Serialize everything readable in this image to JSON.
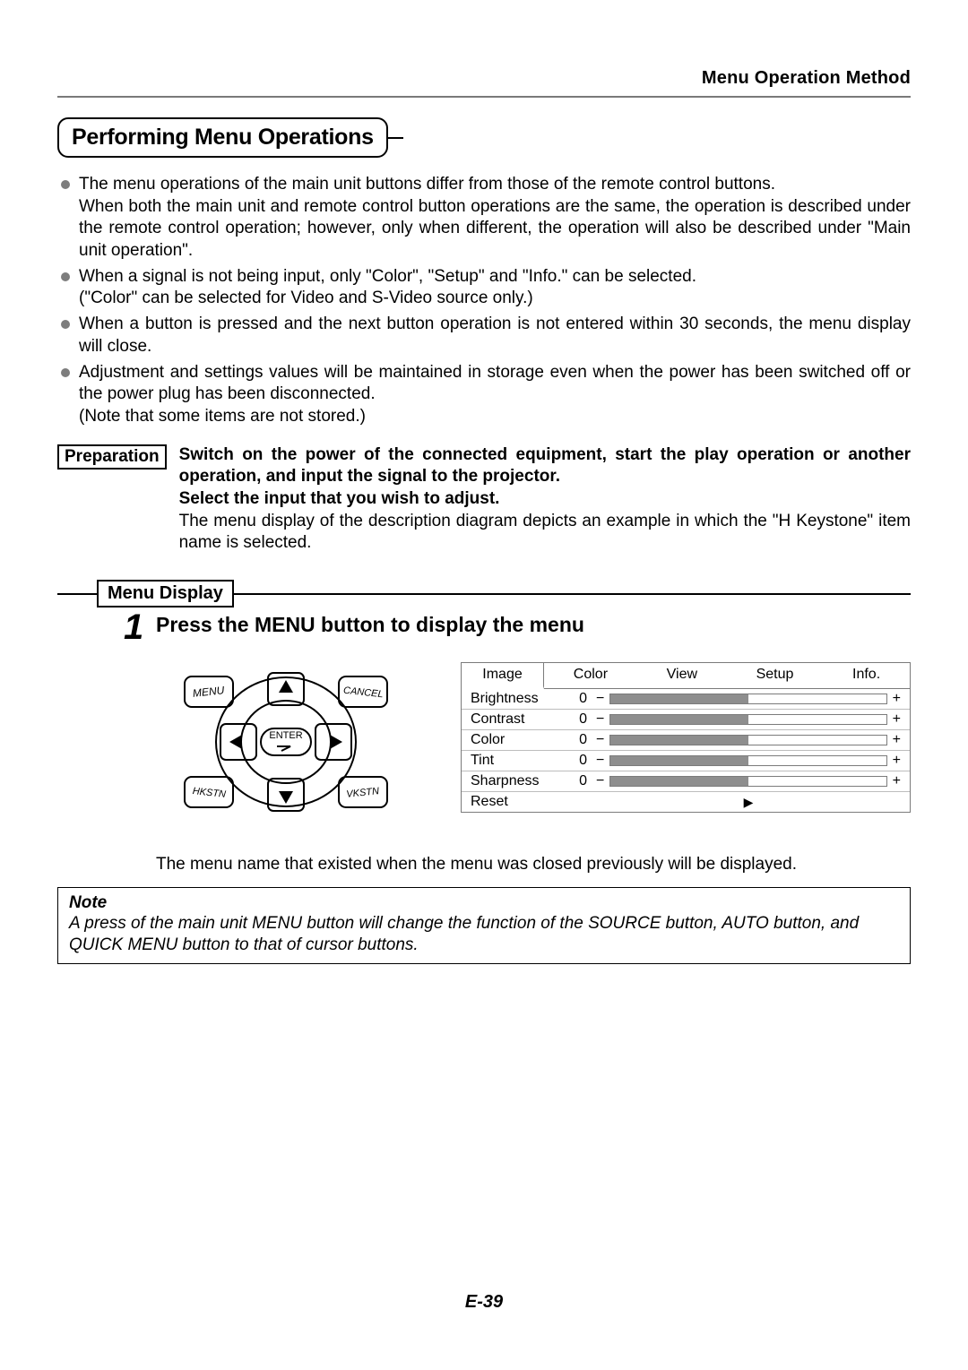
{
  "header": {
    "breadcrumb": "Menu Operation Method"
  },
  "section": {
    "title": "Performing Menu Operations"
  },
  "bullets": [
    {
      "main": "The menu operations of the main unit buttons differ from those of the remote control buttons.",
      "sub": "When both the main unit and remote control button operations are the same, the operation is described under the remote control operation; however, only when different, the operation will also be described under \"Main unit operation\"."
    },
    {
      "main": "When a signal is not being input, only \"Color\", \"Setup\" and \"Info.\" can be selected.",
      "sub": " (\"Color\" can be selected for Video and S-Video source only.)"
    },
    {
      "main": "When a button is pressed and the next button operation is not entered within 30 seconds, the menu display will close."
    },
    {
      "main": "Adjustment and settings values will be maintained in storage even when the power has been switched off or the power plug has been disconnected.",
      "sub": "(Note that some items are not stored.)"
    }
  ],
  "preparation": {
    "label": "Preparation",
    "line1": "Switch on the power of the connected equipment, start the play operation or another operation, and input the signal to the projector.",
    "line2": "Select the input that you wish to adjust.",
    "desc": "The menu display of the description diagram depicts an example in which the \"H Keystone\" item name is selected."
  },
  "step1": {
    "number": "1",
    "label": "Menu Display",
    "command": "Press the MENU button to display the menu",
    "remote": {
      "menu": "MENU",
      "cancel": "CANCEL",
      "enter": "ENTER",
      "hkstn": "HKSTN",
      "vkstn": "VKSTN"
    },
    "osd": {
      "tabs": {
        "active": "Image",
        "others": [
          "Color",
          "View",
          "Setup",
          "Info."
        ]
      },
      "rows": [
        {
          "name": "Brightness",
          "value": "0"
        },
        {
          "name": "Contrast",
          "value": "0"
        },
        {
          "name": "Color",
          "value": "0"
        },
        {
          "name": "Tint",
          "value": "0"
        },
        {
          "name": "Sharpness",
          "value": "0"
        }
      ],
      "reset": "Reset",
      "minus": "−",
      "plus": "+",
      "arrow": "▶"
    },
    "after": "The menu name that existed when the menu was closed previously will be displayed."
  },
  "note": {
    "title": "Note",
    "body": "A press of the main unit MENU button will change the function of the SOURCE button, AUTO button, and QUICK MENU button to that of cursor buttons."
  },
  "page_number": "E-39"
}
